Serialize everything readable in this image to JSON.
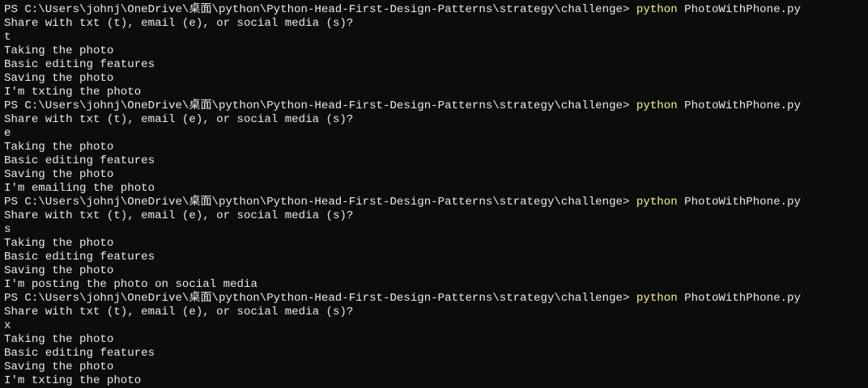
{
  "terminal": {
    "lines": [
      {
        "type": "prompt",
        "prompt": "PS C:\\Users\\johnj\\OneDrive\\桌面\\python\\Python-Head-First-Design-Patterns\\strategy\\challenge> ",
        "command": "python",
        "argument": " PhotoWithPhone.py"
      },
      {
        "type": "output",
        "text": "Share with txt (t), email (e), or social media (s)?"
      },
      {
        "type": "output",
        "text": "t"
      },
      {
        "type": "output",
        "text": "Taking the photo"
      },
      {
        "type": "output",
        "text": "Basic editing features"
      },
      {
        "type": "output",
        "text": "Saving the photo"
      },
      {
        "type": "output",
        "text": "I'm txting the photo"
      },
      {
        "type": "prompt",
        "prompt": "PS C:\\Users\\johnj\\OneDrive\\桌面\\python\\Python-Head-First-Design-Patterns\\strategy\\challenge> ",
        "command": "python",
        "argument": " PhotoWithPhone.py"
      },
      {
        "type": "output",
        "text": "Share with txt (t), email (e), or social media (s)?"
      },
      {
        "type": "output",
        "text": "e"
      },
      {
        "type": "output",
        "text": "Taking the photo"
      },
      {
        "type": "output",
        "text": "Basic editing features"
      },
      {
        "type": "output",
        "text": "Saving the photo"
      },
      {
        "type": "output",
        "text": "I'm emailing the photo"
      },
      {
        "type": "prompt",
        "prompt": "PS C:\\Users\\johnj\\OneDrive\\桌面\\python\\Python-Head-First-Design-Patterns\\strategy\\challenge> ",
        "command": "python",
        "argument": " PhotoWithPhone.py"
      },
      {
        "type": "output",
        "text": "Share with txt (t), email (e), or social media (s)?"
      },
      {
        "type": "output",
        "text": "s"
      },
      {
        "type": "output",
        "text": "Taking the photo"
      },
      {
        "type": "output",
        "text": "Basic editing features"
      },
      {
        "type": "output",
        "text": "Saving the photo"
      },
      {
        "type": "output",
        "text": "I'm posting the photo on social media"
      },
      {
        "type": "prompt",
        "prompt": "PS C:\\Users\\johnj\\OneDrive\\桌面\\python\\Python-Head-First-Design-Patterns\\strategy\\challenge> ",
        "command": "python",
        "argument": " PhotoWithPhone.py"
      },
      {
        "type": "output",
        "text": "Share with txt (t), email (e), or social media (s)?"
      },
      {
        "type": "output",
        "text": "x"
      },
      {
        "type": "output",
        "text": "Taking the photo"
      },
      {
        "type": "output",
        "text": "Basic editing features"
      },
      {
        "type": "output",
        "text": "Saving the photo"
      },
      {
        "type": "output",
        "text": "I'm txting the photo"
      }
    ]
  },
  "colors": {
    "background": "#0c0c0c",
    "foreground": "#eaeaea",
    "command_highlight": "#f7f38a"
  }
}
